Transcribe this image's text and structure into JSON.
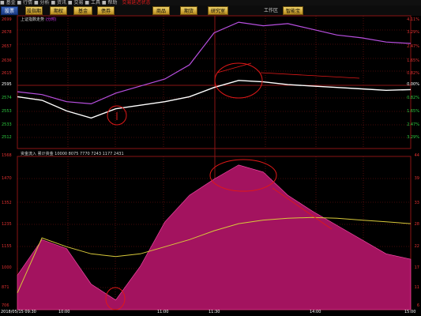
{
  "top_bar": {
    "text": "■ 基金 ■ 行情 ■ 分析 ■ 资讯 ■ 交易 ■ 工具 ■ 帮助",
    "warning": "交易延迟状态"
  },
  "toolbar": {
    "buttons": [
      "股票",
      "股指期货",
      "期权",
      "基金",
      "债券",
      "商品",
      "期货",
      "研究室"
    ],
    "label": "工作区",
    "button_right": "智能宝"
  },
  "upper_panel": {
    "label": "上证指数走势",
    "label_highlight": "(分时)",
    "left_axis": [
      "2699",
      "2678",
      "2657",
      "2636",
      "2615",
      "2595",
      "2574",
      "2553",
      "2533",
      "2512"
    ],
    "right_axis": [
      {
        "text": "4.11%",
        "color": "red"
      },
      {
        "text": "3.29%",
        "color": "red"
      },
      {
        "text": "2.47%",
        "color": "red"
      },
      {
        "text": "1.65%",
        "color": "red"
      },
      {
        "text": "0.82%",
        "color": "red"
      },
      {
        "text": "0.00%",
        "color": "white"
      },
      {
        "text": "0.82%",
        "color": "green"
      },
      {
        "text": "1.65%",
        "color": "green"
      },
      {
        "text": "2.47%",
        "color": "green"
      },
      {
        "text": "3.29%",
        "color": "green"
      }
    ]
  },
  "lower_panel": {
    "label": "资金流入  累计资金  10000  8075  7770  7243  1177  2431",
    "left_axis": [
      "1568",
      "1470",
      "1352",
      "1235",
      "1155",
      "1000",
      "871",
      "706"
    ],
    "right_axis": [
      "44",
      "39",
      "33",
      "28",
      "22",
      "17",
      "11",
      "6"
    ]
  },
  "time_axis": [
    "2018/05/15 09:30",
    "10:00",
    "11:00",
    "11:30",
    "14:00",
    "15:00"
  ],
  "chart_data": {
    "type": "line",
    "x": [
      "09:30",
      "09:45",
      "10:00",
      "10:15",
      "10:30",
      "10:45",
      "11:00",
      "11:15",
      "11:30",
      "13:15",
      "13:30",
      "13:45",
      "14:00",
      "14:15",
      "14:30",
      "14:45",
      "15:00"
    ],
    "series": [
      {
        "values": [
          2585,
          2580,
          2565,
          2555,
          2568,
          2573,
          2578,
          2585,
          2598,
          2608,
          2606,
          2602,
          2600,
          2598,
          2596,
          2594,
          2595
        ]
      },
      {
        "values": [
          2592,
          2588,
          2578,
          2575,
          2590,
          2600,
          2610,
          2630,
          2675,
          2690,
          2685,
          2688,
          2680,
          2672,
          2668,
          2662,
          2660
        ]
      },
      {
        "values": [
          900,
          1100,
          1050,
          850,
          760,
          950,
          1200,
          1350,
          1440,
          1520,
          1480,
          1350,
          1260,
          1180,
          1100,
          1020,
          990
        ]
      },
      {
        "values": [
          800,
          1110,
          1060,
          1020,
          1005,
          1020,
          1060,
          1100,
          1150,
          1190,
          1210,
          1220,
          1225,
          1220,
          1210,
          1200,
          1190
        ]
      }
    ],
    "ylim_upper": [
      2512,
      2699
    ],
    "ylim_lower": [
      706,
      1568
    ]
  },
  "colors": {
    "background": "#000000",
    "grid_red": "#8a1414",
    "price": "#ffffff",
    "index": "#b84fe0",
    "fund_fill": "#a3135f",
    "avg": "#d8c83a",
    "annotation": "#e01818"
  }
}
